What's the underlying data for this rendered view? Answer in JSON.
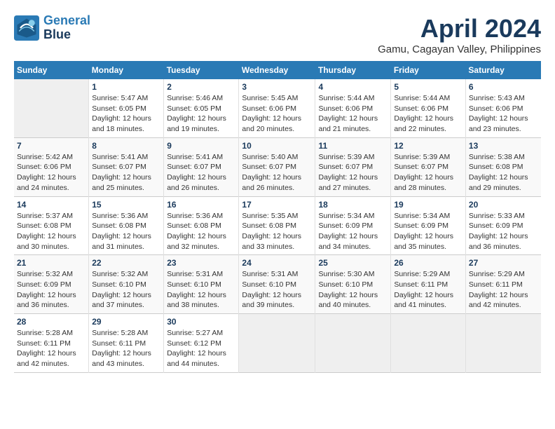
{
  "header": {
    "logo_line1": "General",
    "logo_line2": "Blue",
    "month_title": "April 2024",
    "subtitle": "Gamu, Cagayan Valley, Philippines"
  },
  "columns": [
    "Sunday",
    "Monday",
    "Tuesday",
    "Wednesday",
    "Thursday",
    "Friday",
    "Saturday"
  ],
  "weeks": [
    [
      {
        "day": "",
        "sunrise": "",
        "sunset": "",
        "daylight": "",
        "minutes": ""
      },
      {
        "day": "1",
        "sunrise": "5:47 AM",
        "sunset": "6:05 PM",
        "daylight": "12 hours",
        "minutes": "and 18 minutes."
      },
      {
        "day": "2",
        "sunrise": "5:46 AM",
        "sunset": "6:05 PM",
        "daylight": "12 hours",
        "minutes": "and 19 minutes."
      },
      {
        "day": "3",
        "sunrise": "5:45 AM",
        "sunset": "6:06 PM",
        "daylight": "12 hours",
        "minutes": "and 20 minutes."
      },
      {
        "day": "4",
        "sunrise": "5:44 AM",
        "sunset": "6:06 PM",
        "daylight": "12 hours",
        "minutes": "and 21 minutes."
      },
      {
        "day": "5",
        "sunrise": "5:44 AM",
        "sunset": "6:06 PM",
        "daylight": "12 hours",
        "minutes": "and 22 minutes."
      },
      {
        "day": "6",
        "sunrise": "5:43 AM",
        "sunset": "6:06 PM",
        "daylight": "12 hours",
        "minutes": "and 23 minutes."
      }
    ],
    [
      {
        "day": "7",
        "sunrise": "5:42 AM",
        "sunset": "6:06 PM",
        "daylight": "12 hours",
        "minutes": "and 24 minutes."
      },
      {
        "day": "8",
        "sunrise": "5:41 AM",
        "sunset": "6:07 PM",
        "daylight": "12 hours",
        "minutes": "and 25 minutes."
      },
      {
        "day": "9",
        "sunrise": "5:41 AM",
        "sunset": "6:07 PM",
        "daylight": "12 hours",
        "minutes": "and 26 minutes."
      },
      {
        "day": "10",
        "sunrise": "5:40 AM",
        "sunset": "6:07 PM",
        "daylight": "12 hours",
        "minutes": "and 26 minutes."
      },
      {
        "day": "11",
        "sunrise": "5:39 AM",
        "sunset": "6:07 PM",
        "daylight": "12 hours",
        "minutes": "and 27 minutes."
      },
      {
        "day": "12",
        "sunrise": "5:39 AM",
        "sunset": "6:07 PM",
        "daylight": "12 hours",
        "minutes": "and 28 minutes."
      },
      {
        "day": "13",
        "sunrise": "5:38 AM",
        "sunset": "6:08 PM",
        "daylight": "12 hours",
        "minutes": "and 29 minutes."
      }
    ],
    [
      {
        "day": "14",
        "sunrise": "5:37 AM",
        "sunset": "6:08 PM",
        "daylight": "12 hours",
        "minutes": "and 30 minutes."
      },
      {
        "day": "15",
        "sunrise": "5:36 AM",
        "sunset": "6:08 PM",
        "daylight": "12 hours",
        "minutes": "and 31 minutes."
      },
      {
        "day": "16",
        "sunrise": "5:36 AM",
        "sunset": "6:08 PM",
        "daylight": "12 hours",
        "minutes": "and 32 minutes."
      },
      {
        "day": "17",
        "sunrise": "5:35 AM",
        "sunset": "6:08 PM",
        "daylight": "12 hours",
        "minutes": "and 33 minutes."
      },
      {
        "day": "18",
        "sunrise": "5:34 AM",
        "sunset": "6:09 PM",
        "daylight": "12 hours",
        "minutes": "and 34 minutes."
      },
      {
        "day": "19",
        "sunrise": "5:34 AM",
        "sunset": "6:09 PM",
        "daylight": "12 hours",
        "minutes": "and 35 minutes."
      },
      {
        "day": "20",
        "sunrise": "5:33 AM",
        "sunset": "6:09 PM",
        "daylight": "12 hours",
        "minutes": "and 36 minutes."
      }
    ],
    [
      {
        "day": "21",
        "sunrise": "5:32 AM",
        "sunset": "6:09 PM",
        "daylight": "12 hours",
        "minutes": "and 36 minutes."
      },
      {
        "day": "22",
        "sunrise": "5:32 AM",
        "sunset": "6:10 PM",
        "daylight": "12 hours",
        "minutes": "and 37 minutes."
      },
      {
        "day": "23",
        "sunrise": "5:31 AM",
        "sunset": "6:10 PM",
        "daylight": "12 hours",
        "minutes": "and 38 minutes."
      },
      {
        "day": "24",
        "sunrise": "5:31 AM",
        "sunset": "6:10 PM",
        "daylight": "12 hours",
        "minutes": "and 39 minutes."
      },
      {
        "day": "25",
        "sunrise": "5:30 AM",
        "sunset": "6:10 PM",
        "daylight": "12 hours",
        "minutes": "and 40 minutes."
      },
      {
        "day": "26",
        "sunrise": "5:29 AM",
        "sunset": "6:11 PM",
        "daylight": "12 hours",
        "minutes": "and 41 minutes."
      },
      {
        "day": "27",
        "sunrise": "5:29 AM",
        "sunset": "6:11 PM",
        "daylight": "12 hours",
        "minutes": "and 42 minutes."
      }
    ],
    [
      {
        "day": "28",
        "sunrise": "5:28 AM",
        "sunset": "6:11 PM",
        "daylight": "12 hours",
        "minutes": "and 42 minutes."
      },
      {
        "day": "29",
        "sunrise": "5:28 AM",
        "sunset": "6:11 PM",
        "daylight": "12 hours",
        "minutes": "and 43 minutes."
      },
      {
        "day": "30",
        "sunrise": "5:27 AM",
        "sunset": "6:12 PM",
        "daylight": "12 hours",
        "minutes": "and 44 minutes."
      },
      {
        "day": "",
        "sunrise": "",
        "sunset": "",
        "daylight": "",
        "minutes": ""
      },
      {
        "day": "",
        "sunrise": "",
        "sunset": "",
        "daylight": "",
        "minutes": ""
      },
      {
        "day": "",
        "sunrise": "",
        "sunset": "",
        "daylight": "",
        "minutes": ""
      },
      {
        "day": "",
        "sunrise": "",
        "sunset": "",
        "daylight": "",
        "minutes": ""
      }
    ]
  ]
}
